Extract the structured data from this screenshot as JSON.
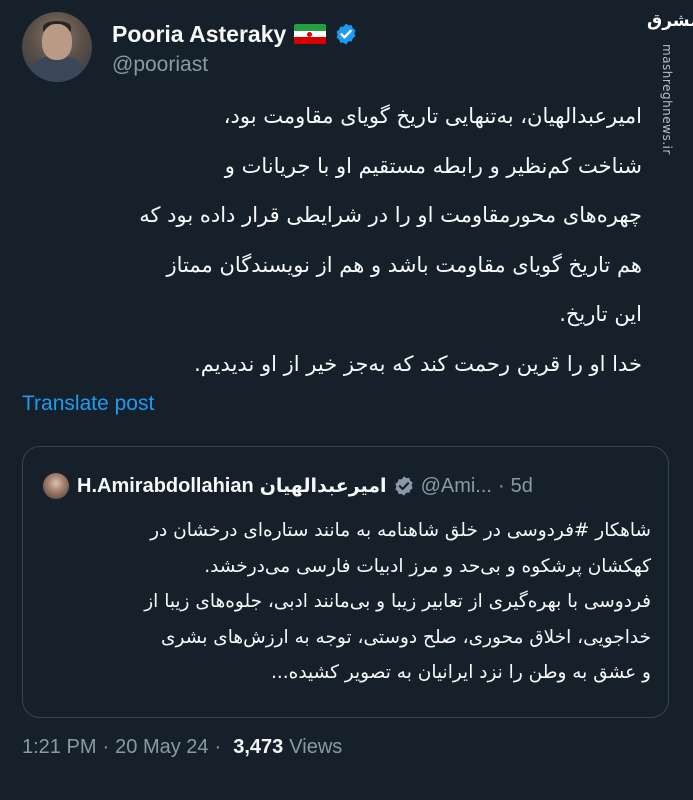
{
  "colors": {
    "background": "#15202b",
    "text_primary": "#f7f9f9",
    "text_secondary": "#8b98a5",
    "link": "#1d9bf0",
    "verified": "#1d9bf0",
    "border": "#38444d"
  },
  "watermark": {
    "logo": "مشرق",
    "url": "mashreghnews.ir"
  },
  "author": {
    "display_name": "Pooria Asteraky",
    "flag_icon": "iran-flag-icon",
    "verified_icon": "verified-badge-icon",
    "handle": "@pooriast"
  },
  "tweet": {
    "lines": [
      "امیرعبدالهیان، به‌تنهایی تاریخ گویای مقاومت بود،",
      "شناخت کم‌نظیر و رابطه مستقیم او با جریانات و",
      "چهره‌های محورمقاومت او را در شرایطی قرار داده بود که",
      "هم تاریخ گویای مقاومت باشد و هم از نویسندگان ممتاز",
      "این تاریخ.",
      "خدا او را قرین رحمت کند که به‌جز خیر از او ندیدیم."
    ],
    "translate_label": "Translate post"
  },
  "quoted": {
    "name": "H.Amirabdollahian",
    "name_fa": "امیرعبدالهیان",
    "handle": "@Ami...",
    "separator": "·",
    "time": "5d",
    "lines": [
      "شاهکار #فردوسی در خلق شاهنامه به مانند ستاره‌ای درخشان در",
      "کهکشان پرشکوه و بی‌حد و مرز ادبیات فارسی می‌درخشد.",
      "فردوسی با بهره‌گیری از تعابیر زیبا و بی‌مانند ادبی، جلوه‌های زیبا از",
      "خداجویی، اخلاق محوری، صلح دوستی، توجه به ارزش‌های بشری",
      "و عشق به وطن را نزد ایرانیان به تصویر کشیده..."
    ]
  },
  "meta": {
    "time": "1:21 PM",
    "separator": "·",
    "date": "20 May 24",
    "views_count": "3,473",
    "views_label": "Views"
  }
}
